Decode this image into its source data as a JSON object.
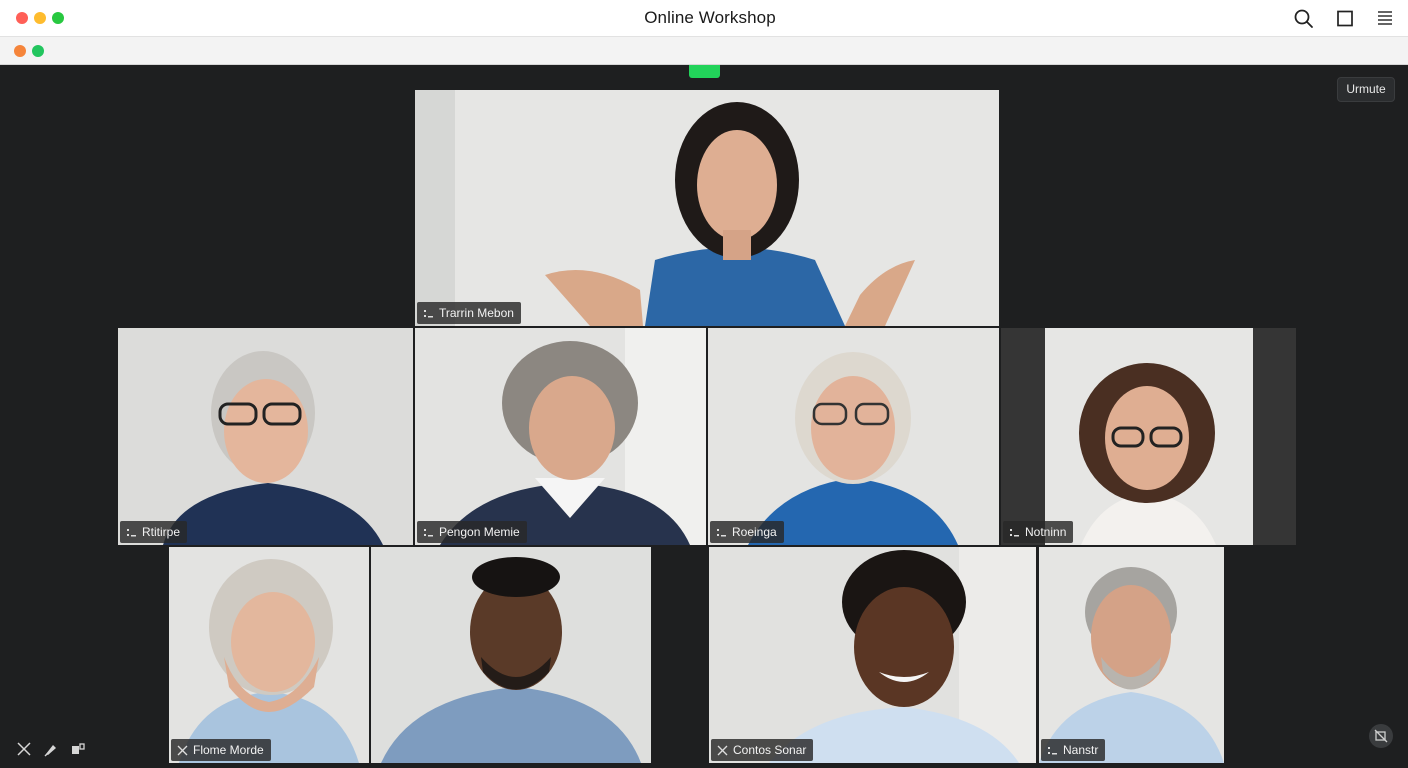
{
  "window": {
    "title": "Online Workshop"
  },
  "controls": {
    "unmute_label": "Urmute"
  },
  "participants": {
    "host": {
      "name": "Trarrin Mebon"
    },
    "p1": {
      "name": "Rtitirpe"
    },
    "p2": {
      "name": "Pengon Memie"
    },
    "p3": {
      "name": "Roeinga"
    },
    "p4": {
      "name": "Notninn"
    },
    "p5": {
      "name": "Flome Morde"
    },
    "p6": {
      "name": ""
    },
    "p7": {
      "name": "Contos Sonar"
    },
    "p8": {
      "name": "Nanstr"
    }
  },
  "colors": {
    "accent_green": "#22d35a",
    "traffic_red": "#ff5f57",
    "traffic_yellow": "#febc2e",
    "traffic_green": "#28c840",
    "stage_bg": "#1e1f20"
  },
  "icons": {
    "toolbar": [
      "search-icon",
      "window-icon",
      "menu-icon"
    ],
    "bottom_left": [
      "collapse-icon",
      "pin-icon",
      "layout-icon"
    ],
    "bottom_right": "no-camera-icon"
  }
}
